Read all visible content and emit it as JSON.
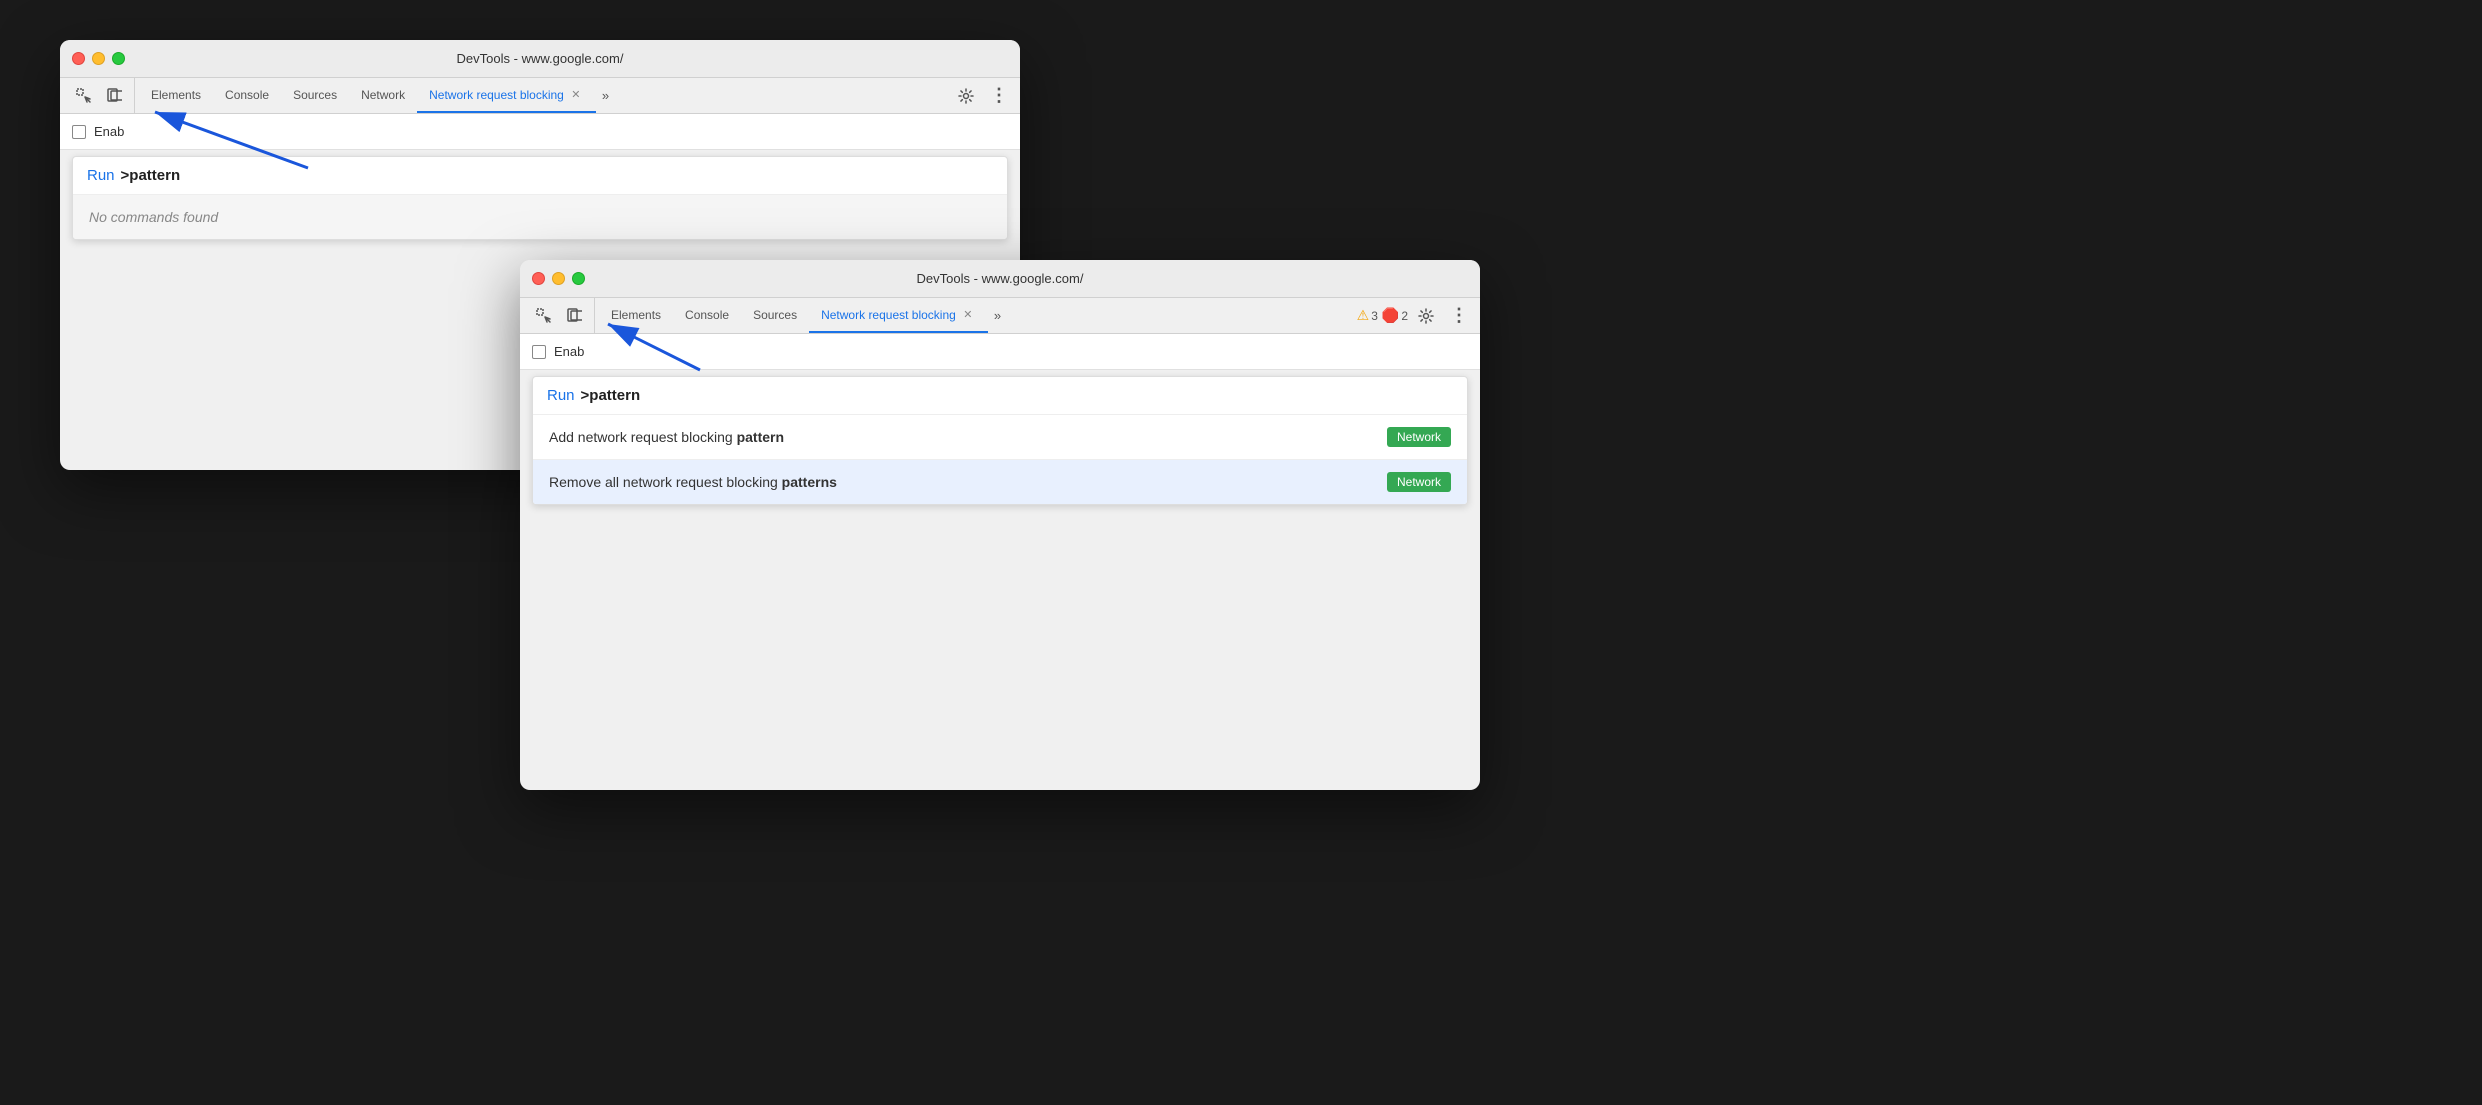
{
  "window1": {
    "title": "DevTools - www.google.com/",
    "tabs": [
      {
        "label": "Elements",
        "active": false
      },
      {
        "label": "Console",
        "active": false
      },
      {
        "label": "Sources",
        "active": false
      },
      {
        "label": "Network",
        "active": false
      },
      {
        "label": "Network request blocking",
        "active": true
      }
    ],
    "toolbar": {
      "checkbox_label": "Enab"
    },
    "command_palette": {
      "run_label": "Run",
      "pattern_label": ">pattern",
      "no_commands": "No commands found"
    }
  },
  "window2": {
    "title": "DevTools - www.google.com/",
    "tabs": [
      {
        "label": "Elements",
        "active": false
      },
      {
        "label": "Console",
        "active": false
      },
      {
        "label": "Sources",
        "active": false
      },
      {
        "label": "Network request blocking",
        "active": true
      }
    ],
    "warnings": {
      "icon": "⚠",
      "count": "3"
    },
    "errors": {
      "icon": "🔴",
      "count": "2"
    },
    "toolbar": {
      "checkbox_label": "Enab"
    },
    "command_palette": {
      "run_label": "Run",
      "pattern_label": ">pattern"
    },
    "commands": [
      {
        "text_before": "Add network request blocking ",
        "text_bold": "pattern",
        "text_after": "",
        "badge": "Network",
        "highlighted": false
      },
      {
        "text_before": "Remove all network request blocking ",
        "text_bold": "pattern",
        "text_after": "s",
        "badge": "Network",
        "highlighted": true
      }
    ]
  },
  "arrow": {
    "label": "blue annotation arrow"
  }
}
